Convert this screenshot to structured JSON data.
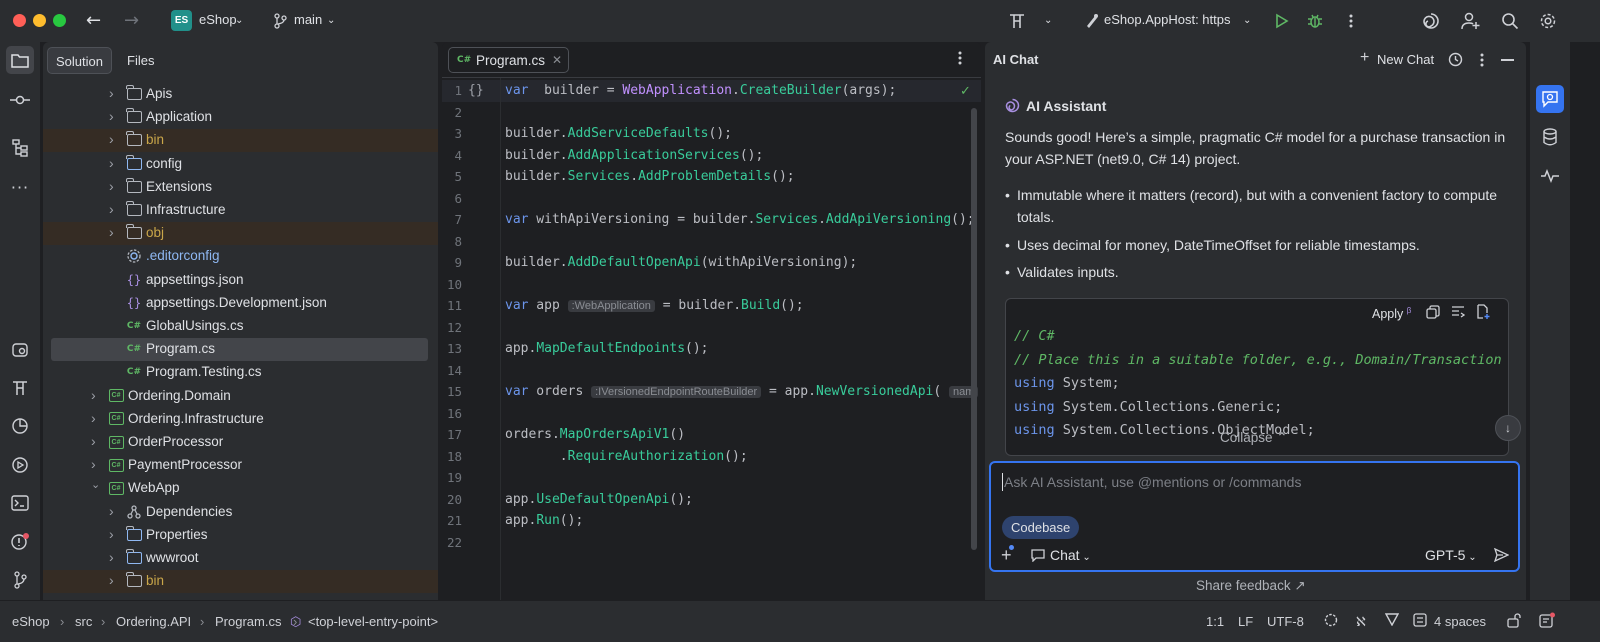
{
  "titlebar": {
    "project_badge": "ES",
    "project_name": "eShop",
    "branch": "main",
    "run_config": "eShop.AppHost: https"
  },
  "project_panel": {
    "tabs": [
      "Solution",
      "Files"
    ],
    "tree": [
      {
        "label": "Apis",
        "type": "folder",
        "depth": 2,
        "chevron": "›"
      },
      {
        "label": "Application",
        "type": "folder",
        "depth": 2,
        "chevron": "›"
      },
      {
        "label": "bin",
        "type": "folder-excluded",
        "depth": 2,
        "chevron": "›"
      },
      {
        "label": "config",
        "type": "folder-special",
        "depth": 2,
        "chevron": "›"
      },
      {
        "label": "Extensions",
        "type": "folder",
        "depth": 2,
        "chevron": "›"
      },
      {
        "label": "Infrastructure",
        "type": "folder",
        "depth": 2,
        "chevron": "›"
      },
      {
        "label": "obj",
        "type": "folder-excluded",
        "depth": 2,
        "chevron": "›"
      },
      {
        "label": ".editorconfig",
        "type": "editorconfig",
        "depth": 2,
        "chevron": ""
      },
      {
        "label": "appsettings.json",
        "type": "json",
        "depth": 2,
        "chevron": ""
      },
      {
        "label": "appsettings.Development.json",
        "type": "json",
        "depth": 2,
        "chevron": ""
      },
      {
        "label": "GlobalUsings.cs",
        "type": "cs",
        "depth": 2,
        "chevron": ""
      },
      {
        "label": "Program.cs",
        "type": "cs",
        "depth": 2,
        "chevron": "",
        "selected": true
      },
      {
        "label": "Program.Testing.cs",
        "type": "cs",
        "depth": 2,
        "chevron": ""
      },
      {
        "label": "Ordering.Domain",
        "type": "csproj",
        "depth": 1,
        "chevron": "›"
      },
      {
        "label": "Ordering.Infrastructure",
        "type": "csproj",
        "depth": 1,
        "chevron": "›"
      },
      {
        "label": "OrderProcessor",
        "type": "csproj",
        "depth": 1,
        "chevron": "›"
      },
      {
        "label": "PaymentProcessor",
        "type": "csproj",
        "depth": 1,
        "chevron": "›"
      },
      {
        "label": "WebApp",
        "type": "csproj",
        "depth": 1,
        "chevron": "⌄"
      },
      {
        "label": "Dependencies",
        "type": "deps",
        "depth": 2,
        "chevron": "›"
      },
      {
        "label": "Properties",
        "type": "folder-special",
        "depth": 2,
        "chevron": "›"
      },
      {
        "label": "wwwroot",
        "type": "folder-web",
        "depth": 2,
        "chevron": "›"
      },
      {
        "label": "bin",
        "type": "folder-excluded",
        "depth": 2,
        "chevron": "›"
      }
    ]
  },
  "editor": {
    "tab_label": "Program.cs",
    "tab_icon": "C#",
    "lines": [
      {
        "n": "1",
        "gutter": "{}",
        "tokens": [
          [
            "kw",
            "var"
          ],
          [
            "",
            "  builder = "
          ],
          [
            "ty",
            "WebApplication"
          ],
          [
            "",
            "."
          ],
          [
            "me",
            "CreateBuilder"
          ],
          [
            "",
            "(args);"
          ]
        ]
      },
      {
        "n": "2",
        "tokens": []
      },
      {
        "n": "3",
        "tokens": [
          [
            "",
            "builder."
          ],
          [
            "me",
            "AddServiceDefaults"
          ],
          [
            "",
            "();"
          ]
        ]
      },
      {
        "n": "4",
        "tokens": [
          [
            "",
            "builder."
          ],
          [
            "me",
            "AddApplicationServices"
          ],
          [
            "",
            "();"
          ]
        ]
      },
      {
        "n": "5",
        "tokens": [
          [
            "",
            "builder."
          ],
          [
            "me",
            "Services"
          ],
          [
            "",
            "."
          ],
          [
            "me",
            "AddProblemDetails"
          ],
          [
            "",
            "();"
          ]
        ]
      },
      {
        "n": "6",
        "tokens": []
      },
      {
        "n": "7",
        "tokens": [
          [
            "kw",
            "var"
          ],
          [
            "",
            " withApiVersioning = builder."
          ],
          [
            "me",
            "Services"
          ],
          [
            "",
            "."
          ],
          [
            "me",
            "AddApiVersioning"
          ],
          [
            "",
            "();"
          ]
        ]
      },
      {
        "n": "8",
        "tokens": []
      },
      {
        "n": "9",
        "tokens": [
          [
            "",
            "builder."
          ],
          [
            "me",
            "AddDefaultOpenApi"
          ],
          [
            "",
            "(withApiVersioning);"
          ]
        ]
      },
      {
        "n": "10",
        "tokens": []
      },
      {
        "n": "11",
        "tokens": [
          [
            "kw",
            "var"
          ],
          [
            "",
            " app "
          ],
          [
            "hint",
            ":WebApplication"
          ],
          [
            "",
            " = builder."
          ],
          [
            "me",
            "Build"
          ],
          [
            "",
            "();"
          ]
        ]
      },
      {
        "n": "12",
        "tokens": []
      },
      {
        "n": "13",
        "tokens": [
          [
            "",
            "app."
          ],
          [
            "me",
            "MapDefaultEndpoints"
          ],
          [
            "",
            "();"
          ]
        ]
      },
      {
        "n": "14",
        "tokens": []
      },
      {
        "n": "15",
        "tokens": [
          [
            "kw",
            "var"
          ],
          [
            "",
            " orders "
          ],
          [
            "hint",
            ":IVersionedEndpointRouteBuilder"
          ],
          [
            "",
            " = app."
          ],
          [
            "me",
            "NewVersionedApi"
          ],
          [
            "",
            "( "
          ],
          [
            "hint",
            "nam"
          ]
        ]
      },
      {
        "n": "16",
        "tokens": []
      },
      {
        "n": "17",
        "tokens": [
          [
            "",
            "orders."
          ],
          [
            "me",
            "MapOrdersApiV1"
          ],
          [
            "",
            "()"
          ]
        ]
      },
      {
        "n": "18",
        "tokens": [
          [
            "",
            "       ."
          ],
          [
            "me",
            "RequireAuthorization"
          ],
          [
            "",
            "();"
          ]
        ]
      },
      {
        "n": "19",
        "tokens": []
      },
      {
        "n": "20",
        "tokens": [
          [
            "",
            "app."
          ],
          [
            "me",
            "UseDefaultOpenApi"
          ],
          [
            "",
            "();"
          ]
        ]
      },
      {
        "n": "21",
        "tokens": [
          [
            "",
            "app."
          ],
          [
            "me",
            "Run"
          ],
          [
            "",
            "();"
          ]
        ]
      },
      {
        "n": "22",
        "tokens": []
      }
    ]
  },
  "ai_chat": {
    "title": "AI Chat",
    "new_chat": "New Chat",
    "assistant_name": "AI Assistant",
    "intro": "Sounds good! Here’s a simple, pragmatic C# model for a purchase transaction in your ASP.NET (net9.0, C# 14) project.",
    "bullets": [
      "Immutable where it matters (record), but with a convenient factory to compute totals.",
      "Uses decimal for money, DateTimeOffset for reliable timestamps.",
      "Validates inputs."
    ],
    "apply_label": "Apply",
    "apply_beta": "β",
    "code_lines": [
      {
        "cls": "cm",
        "text": "// C#"
      },
      {
        "cls": "cm",
        "text": "// Place this in a suitable folder, e.g., Domain/Transaction"
      },
      {
        "cls": "mix",
        "kw": "using",
        "rest": " System;"
      },
      {
        "cls": "mix",
        "kw": "using",
        "rest": " System.Collections.Generic;"
      },
      {
        "cls": "mix",
        "kw": "using",
        "rest": " System.Collections.ObjectModel;"
      }
    ],
    "collapse": "Collapse",
    "input_placeholder": "Ask AI Assistant, use @mentions or /commands",
    "context_chip": "Codebase",
    "mode": "Chat",
    "model": "GPT-5",
    "feedback": "Share feedback"
  },
  "statusbar": {
    "breadcrumb": [
      "eShop",
      "src",
      "Ordering.API",
      "Program.cs",
      "<top-level-entry-point>"
    ],
    "position": "1:1",
    "line_ending": "LF",
    "encoding": "UTF-8",
    "indent": "4 spaces"
  },
  "colors": {
    "accent": "#3574f0",
    "keyword": "#6c95eb",
    "type": "#c191ff",
    "method": "#39cc9b",
    "comment": "#5fb865",
    "excluded": "#c9a64a"
  }
}
